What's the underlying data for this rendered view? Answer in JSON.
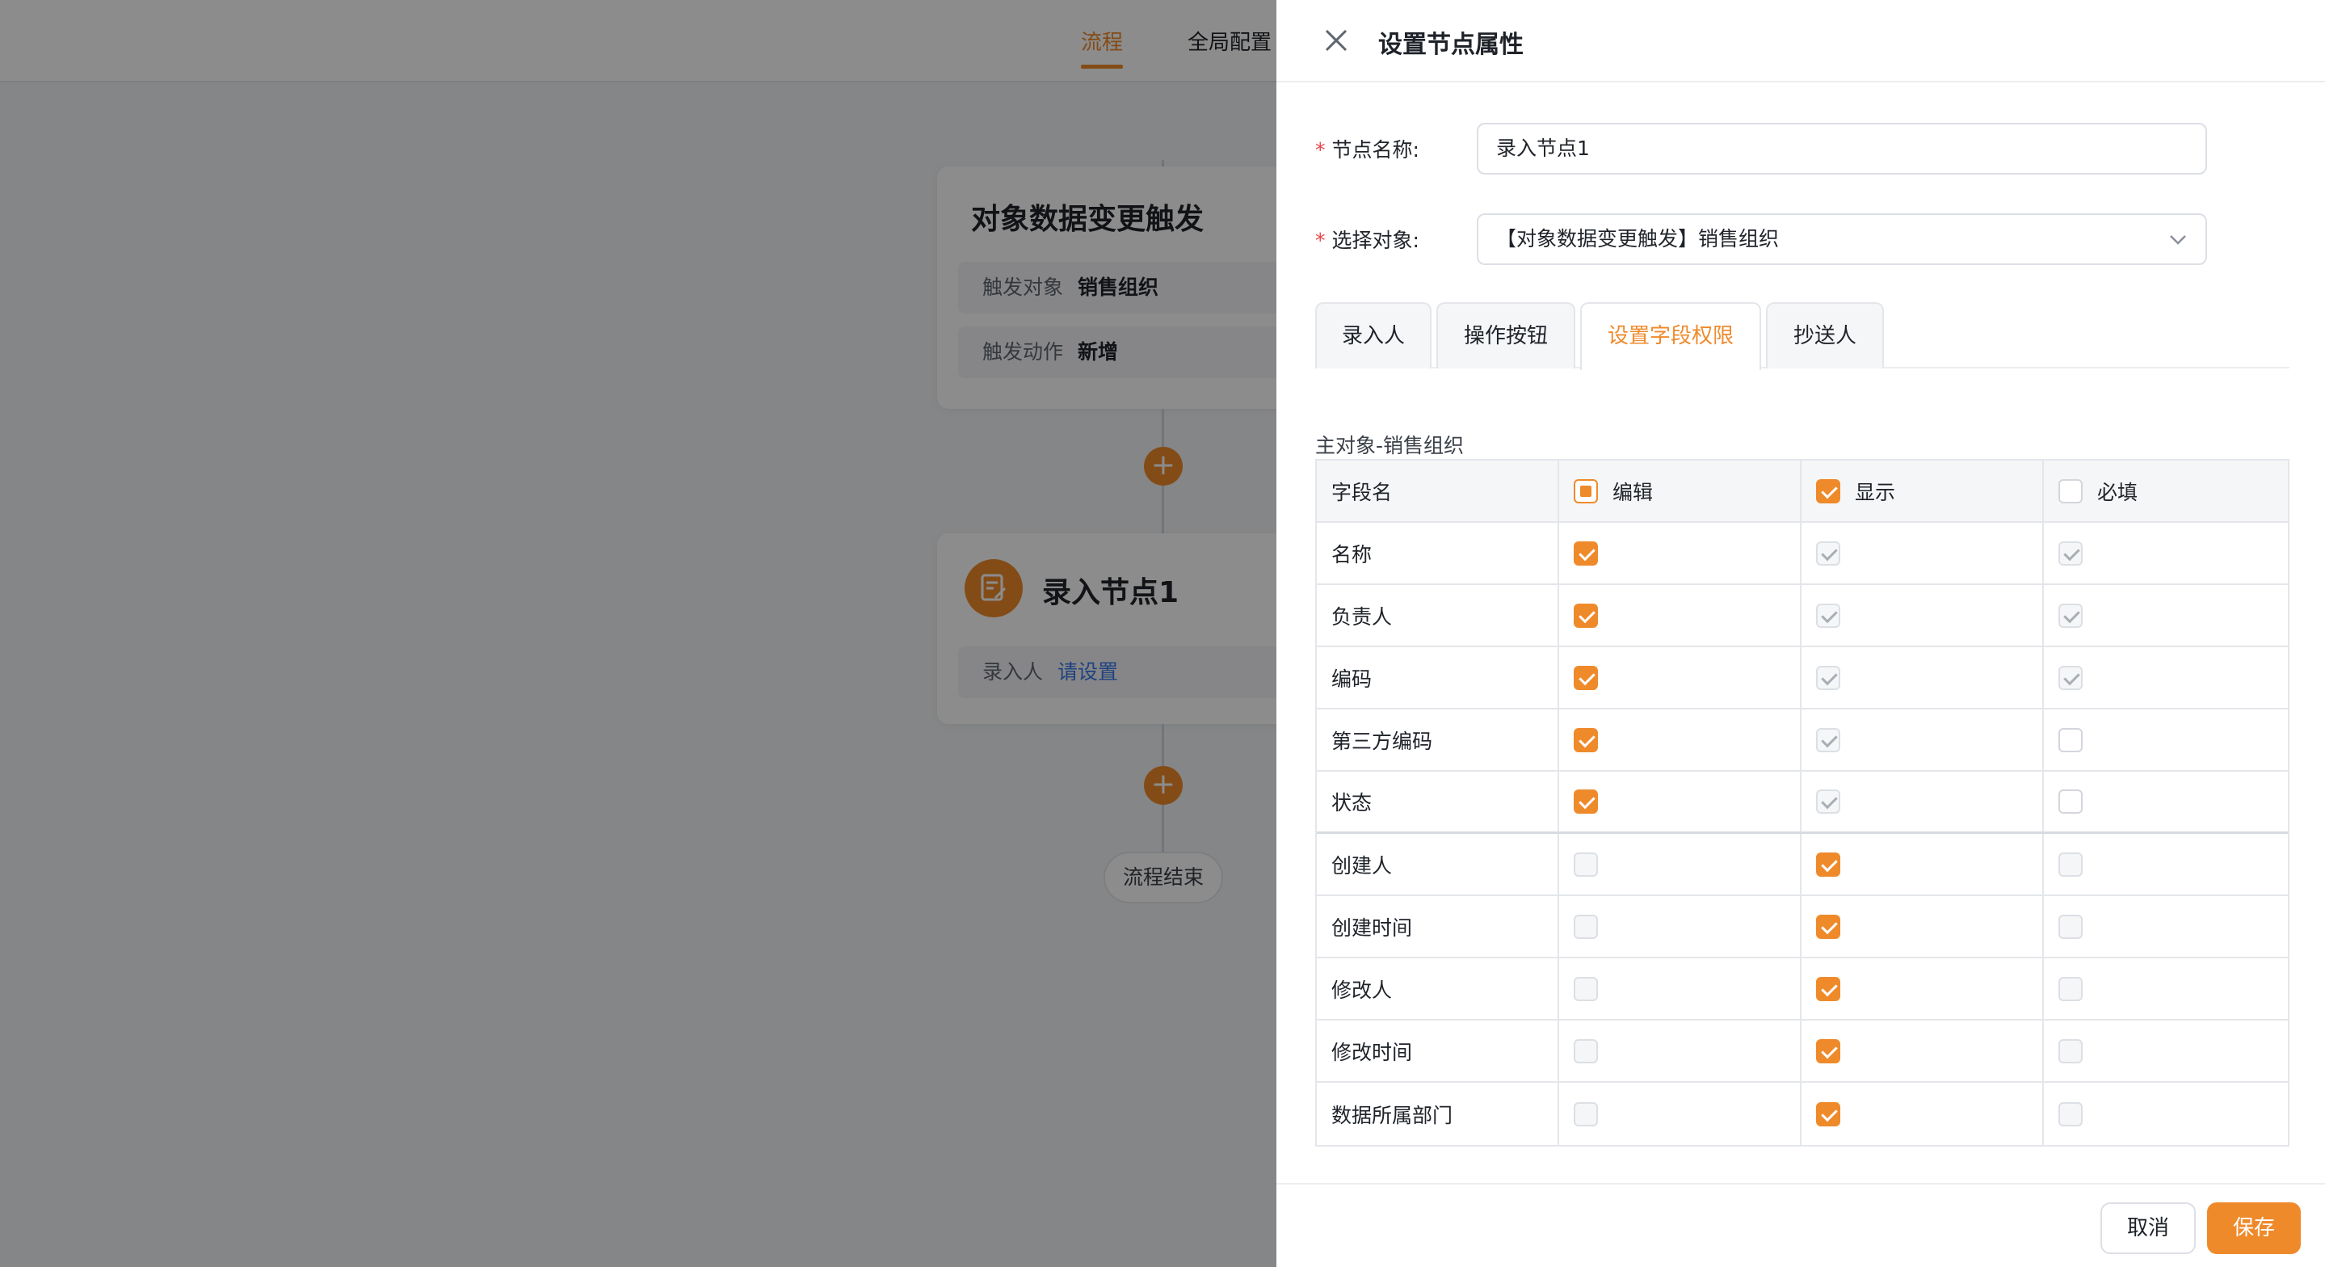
{
  "background": {
    "tabs": [
      {
        "label": "流程",
        "active": true
      },
      {
        "label": "全局配置",
        "active": false
      }
    ],
    "trigger_card": {
      "title": "对象数据变更触发",
      "rows": [
        {
          "key": "触发对象",
          "value": "销售组织"
        },
        {
          "key": "触发动作",
          "value": "新增"
        }
      ]
    },
    "input_node_card": {
      "title": "录入节点1",
      "row_key": "录入人",
      "row_link": "请设置"
    },
    "end_label": "流程结束",
    "accent_color": "#ef8a2b"
  },
  "drawer": {
    "title": "设置节点属性",
    "form": {
      "name_label": "节点名称:",
      "name_value": "录入节点1",
      "object_label": "选择对象:",
      "object_value": "【对象数据变更触发】销售组织"
    },
    "tabs": [
      {
        "label": "录入人",
        "active": false
      },
      {
        "label": "操作按钮",
        "active": false
      },
      {
        "label": "设置字段权限",
        "active": true
      },
      {
        "label": "抄送人",
        "active": false
      }
    ],
    "section_label": "主对象-销售组织",
    "table": {
      "headers": {
        "field": "字段名",
        "edit": "编辑",
        "show": "显示",
        "required": "必填"
      },
      "header_state": {
        "edit": "indeterminate",
        "show": "checked",
        "required": "unchecked"
      },
      "rows": [
        {
          "name": "名称",
          "edit": "checked",
          "show": "checked-disabled",
          "required": "checked-disabled"
        },
        {
          "name": "负责人",
          "edit": "checked",
          "show": "checked-disabled",
          "required": "checked-disabled"
        },
        {
          "name": "编码",
          "edit": "checked",
          "show": "checked-disabled",
          "required": "checked-disabled"
        },
        {
          "name": "第三方编码",
          "edit": "checked",
          "show": "checked-disabled",
          "required": "unchecked"
        },
        {
          "name": "状态",
          "edit": "checked",
          "show": "checked-disabled",
          "required": "unchecked"
        },
        {
          "name": "创建人",
          "edit": "disabled",
          "show": "checked",
          "required": "disabled"
        },
        {
          "name": "创建时间",
          "edit": "disabled",
          "show": "checked",
          "required": "disabled"
        },
        {
          "name": "修改人",
          "edit": "disabled",
          "show": "checked",
          "required": "disabled"
        },
        {
          "name": "修改时间",
          "edit": "disabled",
          "show": "checked",
          "required": "disabled"
        },
        {
          "name": "数据所属部门",
          "edit": "disabled",
          "show": "checked",
          "required": "disabled"
        }
      ]
    },
    "footer": {
      "cancel_label": "取消",
      "save_label": "保存"
    }
  }
}
